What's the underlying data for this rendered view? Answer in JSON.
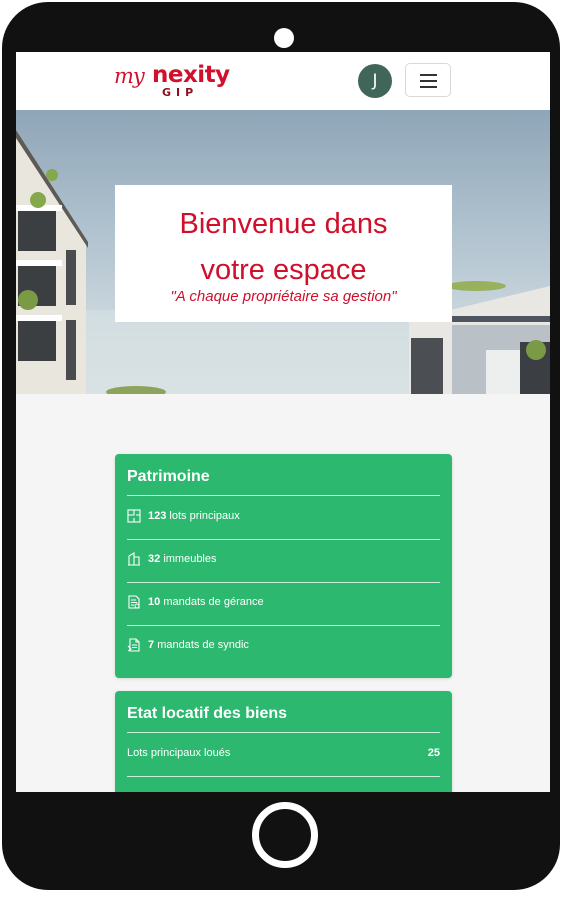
{
  "header": {
    "logo": {
      "my": "my",
      "brand": "nexity",
      "sub": "GIP"
    },
    "avatar_initial": "J",
    "menu_icon": "hamburger-icon"
  },
  "hero": {
    "title_line1": "Bienvenue dans",
    "title_line2": "votre espace",
    "subtitle": "\"A chaque propriétaire sa gestion\""
  },
  "patrimoine": {
    "title": "Patrimoine",
    "items": [
      {
        "icon": "floorplan-icon",
        "count": "123",
        "label": "lots principaux"
      },
      {
        "icon": "building-icon",
        "count": "32",
        "label": "immeubles"
      },
      {
        "icon": "contract-icon",
        "count": "10",
        "label": "mandats de gérance"
      },
      {
        "icon": "document-icon",
        "count": "7",
        "label": "mandats de syndic"
      }
    ]
  },
  "etat_locatif": {
    "title": "Etat locatif des biens",
    "rows": [
      {
        "label": "Lots principaux loués",
        "value": "25"
      }
    ]
  },
  "colors": {
    "brand_red": "#cf0f2b",
    "card_green": "#2cb96f",
    "avatar_green": "#3f6658",
    "device": "#111111"
  }
}
